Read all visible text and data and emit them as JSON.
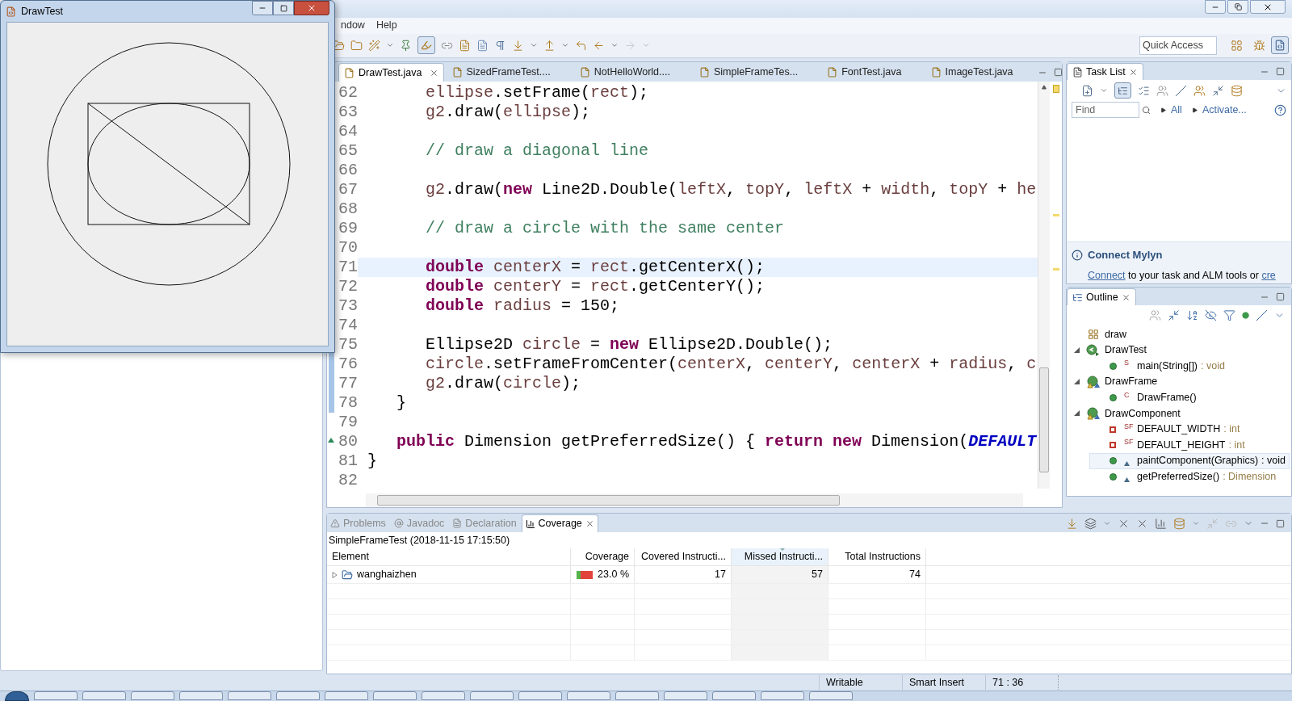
{
  "drawtest_window": {
    "title": "DrawTest"
  },
  "menu": [
    "ndow",
    "Help"
  ],
  "quick_access": {
    "placeholder": "Quick Access"
  },
  "editor": {
    "tabs": [
      {
        "label": "DrawTest.java",
        "selected": true
      },
      {
        "label": "SizedFrameTest....",
        "selected": false
      },
      {
        "label": "NotHelloWorld....",
        "selected": false
      },
      {
        "label": "SimpleFrameTes...",
        "selected": false
      },
      {
        "label": "FontTest.java",
        "selected": false
      },
      {
        "label": "ImageTest.java",
        "selected": false
      }
    ],
    "lines": [
      {
        "number": "62",
        "current": false,
        "changed": false,
        "override": false,
        "kind": "statement",
        "segments": [
          {
            "kind": "local",
            "text": "ellipse"
          },
          {
            "kind": "plain",
            "text": ".setFrame("
          },
          {
            "kind": "local",
            "text": "rect"
          },
          {
            "kind": "plain",
            "text": ");"
          }
        ]
      },
      {
        "number": "63",
        "current": false,
        "changed": false,
        "override": false,
        "kind": "statement",
        "segments": [
          {
            "kind": "local",
            "text": "g2"
          },
          {
            "kind": "plain",
            "text": ".draw("
          },
          {
            "kind": "local",
            "text": "ellipse"
          },
          {
            "kind": "plain",
            "text": ");"
          }
        ]
      },
      {
        "number": "64",
        "current": false,
        "changed": false,
        "override": false,
        "kind": "blank"
      },
      {
        "number": "65",
        "current": false,
        "changed": false,
        "override": false,
        "kind": "statement",
        "segments": [
          {
            "kind": "comment",
            "text": "// draw a diagonal line"
          }
        ]
      },
      {
        "number": "66",
        "current": false,
        "changed": false,
        "override": false,
        "kind": "blank"
      },
      {
        "number": "67",
        "current": false,
        "changed": false,
        "override": false,
        "kind": "statement",
        "segments": [
          {
            "kind": "local",
            "text": "g2"
          },
          {
            "kind": "plain",
            "text": ".draw("
          },
          {
            "kind": "keyword",
            "text": "new"
          },
          {
            "kind": "plain",
            "text": " Line2D.Double("
          },
          {
            "kind": "local",
            "text": "leftX"
          },
          {
            "kind": "plain",
            "text": ", "
          },
          {
            "kind": "local",
            "text": "topY"
          },
          {
            "kind": "plain",
            "text": ", "
          },
          {
            "kind": "local",
            "text": "leftX"
          },
          {
            "kind": "plain",
            "text": " + "
          },
          {
            "kind": "local",
            "text": "width"
          },
          {
            "kind": "plain",
            "text": ", "
          },
          {
            "kind": "local",
            "text": "topY"
          },
          {
            "kind": "plain",
            "text": " + "
          },
          {
            "kind": "local",
            "text": "he"
          }
        ]
      },
      {
        "number": "68",
        "current": false,
        "changed": false,
        "override": false,
        "kind": "blank"
      },
      {
        "number": "69",
        "current": false,
        "changed": false,
        "override": false,
        "kind": "statement",
        "segments": [
          {
            "kind": "comment",
            "text": "// draw a circle with the same center"
          }
        ]
      },
      {
        "number": "70",
        "current": false,
        "changed": false,
        "override": false,
        "kind": "blank"
      },
      {
        "number": "71",
        "current": true,
        "changed": false,
        "override": false,
        "kind": "statement",
        "segments": [
          {
            "kind": "keyword",
            "text": "double"
          },
          {
            "kind": "local",
            "text": " centerX"
          },
          {
            "kind": "plain",
            "text": " = "
          },
          {
            "kind": "local",
            "text": "rect"
          },
          {
            "kind": "plain",
            "text": ".getCenterX();"
          }
        ]
      },
      {
        "number": "72",
        "current": false,
        "changed": false,
        "override": false,
        "kind": "statement",
        "segments": [
          {
            "kind": "keyword",
            "text": "double"
          },
          {
            "kind": "local",
            "text": " centerY"
          },
          {
            "kind": "plain",
            "text": " = "
          },
          {
            "kind": "local",
            "text": "rect"
          },
          {
            "kind": "plain",
            "text": ".getCenterY();"
          }
        ]
      },
      {
        "number": "73",
        "current": false,
        "changed": false,
        "override": false,
        "kind": "statement",
        "segments": [
          {
            "kind": "keyword",
            "text": "double"
          },
          {
            "kind": "local",
            "text": " radius"
          },
          {
            "kind": "plain",
            "text": " = 150;"
          }
        ]
      },
      {
        "number": "74",
        "current": false,
        "changed": false,
        "override": false,
        "kind": "blank"
      },
      {
        "number": "75",
        "current": false,
        "changed": true,
        "override": false,
        "kind": "statement",
        "segments": [
          {
            "kind": "plain",
            "text": "Ellipse2D "
          },
          {
            "kind": "local",
            "text": "circle"
          },
          {
            "kind": "plain",
            "text": " = "
          },
          {
            "kind": "keyword",
            "text": "new"
          },
          {
            "kind": "plain",
            "text": " Ellipse2D.Double();"
          }
        ]
      },
      {
        "number": "76",
        "current": false,
        "changed": true,
        "override": false,
        "kind": "statement",
        "segments": [
          {
            "kind": "local",
            "text": "circle"
          },
          {
            "kind": "plain",
            "text": ".setFrameFromCenter("
          },
          {
            "kind": "local",
            "text": "centerX"
          },
          {
            "kind": "plain",
            "text": ", "
          },
          {
            "kind": "local",
            "text": "centerY"
          },
          {
            "kind": "plain",
            "text": ", "
          },
          {
            "kind": "local",
            "text": "centerX"
          },
          {
            "kind": "plain",
            "text": " + "
          },
          {
            "kind": "local",
            "text": "radius"
          },
          {
            "kind": "plain",
            "text": ", "
          },
          {
            "kind": "local",
            "text": "c"
          }
        ]
      },
      {
        "number": "77",
        "current": false,
        "changed": true,
        "override": false,
        "kind": "statement",
        "segments": [
          {
            "kind": "local",
            "text": "g2"
          },
          {
            "kind": "plain",
            "text": ".draw("
          },
          {
            "kind": "local",
            "text": "circle"
          },
          {
            "kind": "plain",
            "text": ");"
          }
        ]
      },
      {
        "number": "78",
        "current": false,
        "changed": true,
        "override": false,
        "kind": "member",
        "segments": [
          {
            "kind": "plain",
            "text": "}"
          }
        ]
      },
      {
        "number": "79",
        "current": false,
        "changed": false,
        "override": false,
        "kind": "blank"
      },
      {
        "number": "80",
        "current": false,
        "changed": false,
        "override": true,
        "kind": "member",
        "segments": [
          {
            "kind": "keyword",
            "text": "public"
          },
          {
            "kind": "plain",
            "text": " Dimension getPreferredSize() { "
          },
          {
            "kind": "keyword",
            "text": "return new"
          },
          {
            "kind": "plain",
            "text": " Dimension("
          },
          {
            "kind": "field",
            "text": "DEFAULT"
          }
        ]
      },
      {
        "number": "81",
        "current": false,
        "changed": false,
        "override": false,
        "kind": "top",
        "segments": [
          {
            "kind": "plain",
            "text": "}"
          }
        ]
      },
      {
        "number": "82",
        "current": false,
        "changed": false,
        "override": false,
        "kind": "blank"
      }
    ]
  },
  "task_list": {
    "title": "Task List",
    "find": {
      "placeholder": "Find"
    },
    "filters": [
      "All",
      "Activate..."
    ],
    "mylyn": {
      "title": "Connect Mylyn",
      "link": "Connect",
      "text": " to your task and ALM tools or ",
      "link_end": "cre"
    }
  },
  "outline": {
    "title": "Outline",
    "items": [
      {
        "kind": "package",
        "label": "draw",
        "selected": false
      },
      {
        "kind": "main_class",
        "label": "DrawTest",
        "selected": false,
        "expanded": true,
        "children": [
          {
            "kind": "method",
            "label": "main(String[])",
            "modifier": "S",
            "type": " : void",
            "selected": false,
            "override": false
          }
        ]
      },
      {
        "kind": "class",
        "label": "DrawFrame",
        "selected": false,
        "expanded": true,
        "children": [
          {
            "kind": "method",
            "label": "DrawFrame()",
            "modifier": "C",
            "selected": false,
            "override": false
          }
        ]
      },
      {
        "kind": "class",
        "label": "DrawComponent",
        "selected": false,
        "expanded": true,
        "children": [
          {
            "kind": "field",
            "label": "DEFAULT_WIDTH",
            "modifier": "SF",
            "type": " : int",
            "selected": false,
            "override": false
          },
          {
            "kind": "field",
            "label": "DEFAULT_HEIGHT",
            "modifier": "SF",
            "type": " : int",
            "selected": false,
            "override": false
          },
          {
            "kind": "method",
            "label": "paintComponent(Graphics)",
            "type": " : void",
            "selected": true,
            "override": true
          },
          {
            "kind": "method",
            "label": "getPreferredSize()",
            "type": " : Dimension",
            "selected": false,
            "override": true
          }
        ]
      }
    ]
  },
  "bottom": {
    "tabs": [
      {
        "label": "Problems",
        "selected": false
      },
      {
        "label": "Javadoc",
        "selected": false
      },
      {
        "label": "Declaration",
        "selected": false
      },
      {
        "label": "Coverage",
        "selected": true
      }
    ],
    "session": "SimpleFrameTest (2018-11-15 17:15:50)",
    "columns": [
      {
        "label": "Element",
        "selected": false
      },
      {
        "label": "Coverage",
        "selected": false
      },
      {
        "label": "Covered Instructi...",
        "selected": false
      },
      {
        "label": "Missed Instructi...",
        "selected": true
      },
      {
        "label": "Total Instructions",
        "selected": false
      }
    ],
    "rows": [
      {
        "element": "wanghaizhen",
        "expanded": false,
        "coverage": "23.0 %",
        "level": 0.23,
        "covered": "17",
        "missed": "57",
        "total": "74"
      }
    ]
  },
  "status_bar": [
    "Writable",
    "Smart Insert",
    "71 : 36"
  ]
}
